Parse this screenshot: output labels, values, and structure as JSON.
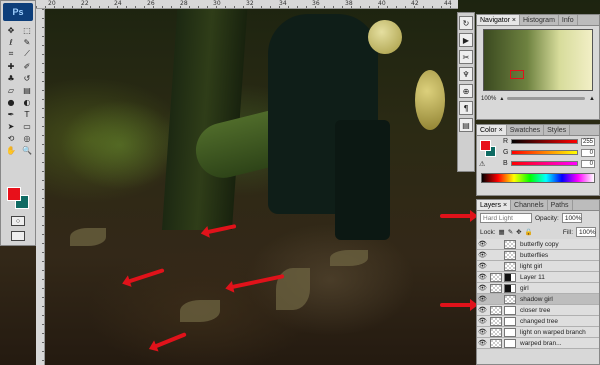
{
  "app": {
    "logo": "Ps"
  },
  "rulers": {
    "top_labels": [
      "20",
      "22",
      "24",
      "26",
      "28",
      "30",
      "32",
      "34",
      "36",
      "38",
      "40",
      "42",
      "44"
    ]
  },
  "tools": {
    "items": [
      {
        "name": "move-tool",
        "glyph": "✥"
      },
      {
        "name": "marquee-tool",
        "glyph": "⬚"
      },
      {
        "name": "lasso-tool",
        "glyph": "ℓ"
      },
      {
        "name": "quick-select-tool",
        "glyph": "✎"
      },
      {
        "name": "crop-tool",
        "glyph": "⌗"
      },
      {
        "name": "slice-tool",
        "glyph": "⟋"
      },
      {
        "name": "healing-tool",
        "glyph": "✚"
      },
      {
        "name": "brush-tool",
        "glyph": "✐"
      },
      {
        "name": "stamp-tool",
        "glyph": "♣"
      },
      {
        "name": "history-brush-tool",
        "glyph": "↺"
      },
      {
        "name": "eraser-tool",
        "glyph": "▱"
      },
      {
        "name": "gradient-tool",
        "glyph": "▤"
      },
      {
        "name": "blur-tool",
        "glyph": "●"
      },
      {
        "name": "dodge-tool",
        "glyph": "◐"
      },
      {
        "name": "pen-tool",
        "glyph": "✒"
      },
      {
        "name": "type-tool",
        "glyph": "T"
      },
      {
        "name": "path-select-tool",
        "glyph": "➤"
      },
      {
        "name": "shape-tool",
        "glyph": "▭"
      },
      {
        "name": "3d-rotate-tool",
        "glyph": "⟲"
      },
      {
        "name": "3d-orbit-tool",
        "glyph": "◎"
      },
      {
        "name": "hand-tool",
        "glyph": "✋"
      },
      {
        "name": "zoom-tool",
        "glyph": "🔍"
      }
    ],
    "foreground_color": "#e8101a",
    "background_color": "#0f6b63"
  },
  "navigator_panel": {
    "tabs": [
      "Navigator ×",
      "Histogram",
      "Info"
    ],
    "zoom": "100%"
  },
  "color_panel": {
    "tabs": [
      "Color ×",
      "Swatches",
      "Styles"
    ],
    "channels": [
      {
        "label": "R",
        "value": "255",
        "gradient": "linear-gradient(90deg,#000,#f00)"
      },
      {
        "label": "G",
        "value": "0",
        "gradient": "linear-gradient(90deg,#f00,#ff0)"
      },
      {
        "label": "B",
        "value": "0",
        "gradient": "linear-gradient(90deg,#f00,#f0f)"
      }
    ]
  },
  "layers_panel": {
    "tabs": [
      "Layers ×",
      "Channels",
      "Paths"
    ],
    "blend_mode": "Hard Light",
    "opacity_label": "Opacity:",
    "opacity_value": "100%",
    "lock_label": "Lock:",
    "fill_label": "Fill:",
    "fill_value": "100%",
    "layers": [
      {
        "name": "butterfly copy",
        "type": "plain"
      },
      {
        "name": "butterflies",
        "type": "plain"
      },
      {
        "name": "light girl",
        "type": "plain"
      },
      {
        "name": "Layer 11",
        "type": "masked"
      },
      {
        "name": "girl",
        "type": "masked"
      },
      {
        "name": "shadow girl",
        "type": "plain",
        "selected": true
      },
      {
        "name": "closer tree",
        "type": "masked-top"
      },
      {
        "name": "changed tree",
        "type": "masked-top"
      },
      {
        "name": "light on warped branch",
        "type": "masked-top"
      },
      {
        "name": "warped bran...",
        "type": "masked-top"
      }
    ]
  },
  "annotation_color": "#e0121a"
}
